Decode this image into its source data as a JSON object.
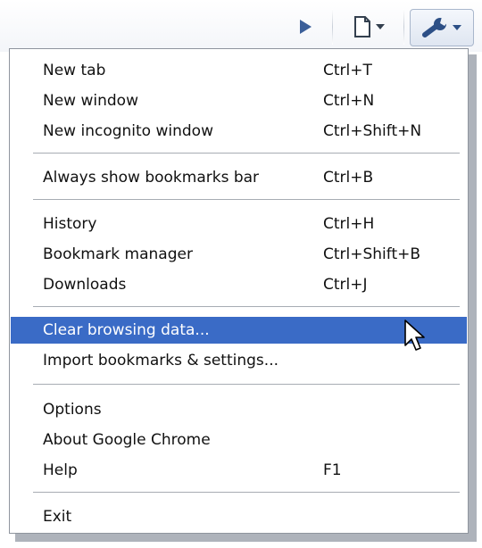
{
  "toolbar": {
    "buttons": [
      {
        "name": "play-button",
        "icon": "play-icon"
      },
      {
        "name": "page-menu-button",
        "icon": "page-icon"
      },
      {
        "name": "wrench-menu-button",
        "icon": "wrench-icon"
      }
    ]
  },
  "menu": {
    "highlight_color": "#3a6bc6",
    "items": [
      {
        "label": "New tab",
        "shortcut": "Ctrl+T"
      },
      {
        "label": "New window",
        "shortcut": "Ctrl+N"
      },
      {
        "label": "New incognito window",
        "shortcut": "Ctrl+Shift+N"
      },
      {
        "label": "Always show bookmarks bar",
        "shortcut": "Ctrl+B"
      },
      {
        "label": "History",
        "shortcut": "Ctrl+H"
      },
      {
        "label": "Bookmark manager",
        "shortcut": "Ctrl+Shift+B"
      },
      {
        "label": "Downloads",
        "shortcut": "Ctrl+J"
      },
      {
        "label": "Clear browsing data...",
        "shortcut": "",
        "selected": true
      },
      {
        "label": "Import bookmarks & settings...",
        "shortcut": ""
      },
      {
        "label": "Options",
        "shortcut": ""
      },
      {
        "label": "About Google Chrome",
        "shortcut": ""
      },
      {
        "label": "Help",
        "shortcut": "F1"
      },
      {
        "label": "Exit",
        "shortcut": ""
      }
    ]
  }
}
